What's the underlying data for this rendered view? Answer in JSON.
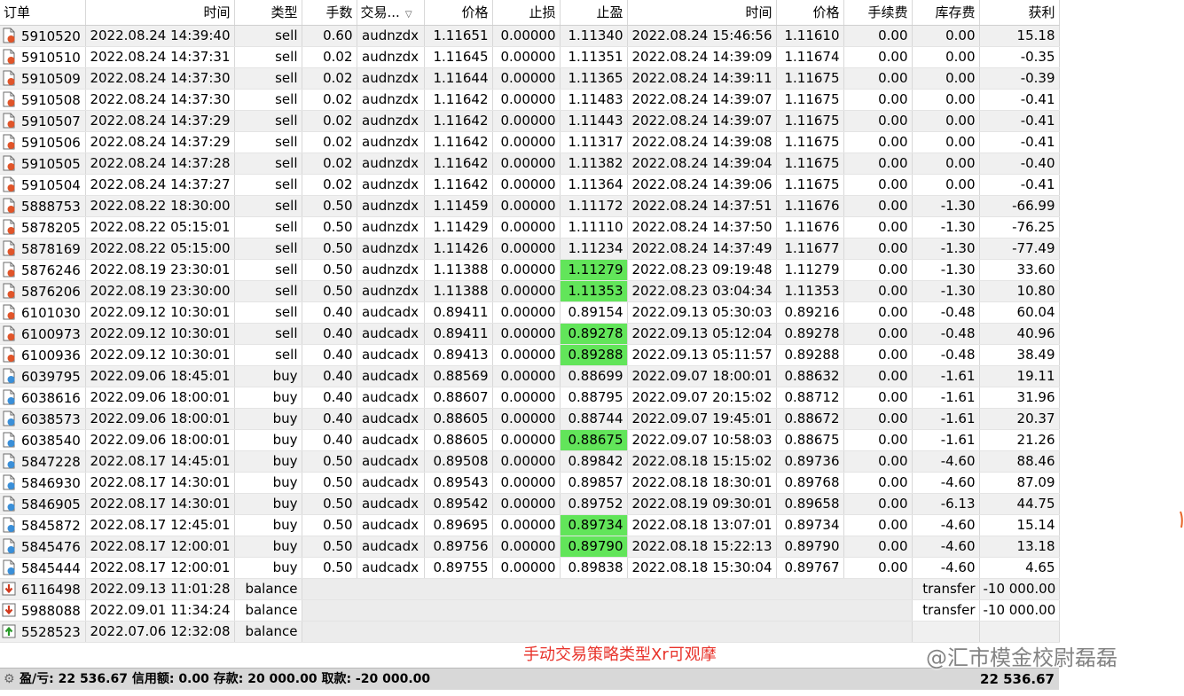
{
  "columns": [
    "订单",
    "时间",
    "类型",
    "手数",
    "交易...",
    "价格",
    "止损",
    "止盈",
    "时间",
    "价格",
    "手续费",
    "库存费",
    "获利"
  ],
  "rows": [
    {
      "order": "5910520",
      "open_time": "2022.08.24 14:39:40",
      "type": "sell",
      "lots": "0.60",
      "symbol": "audnzdx",
      "open_price": "1.11651",
      "sl": "0.00000",
      "tp": "1.11340",
      "tp_hit": false,
      "close_time": "2022.08.24 15:46:56",
      "close_price": "1.11610",
      "commission": "0.00",
      "swap": "0.00",
      "profit": "15.18"
    },
    {
      "order": "5910510",
      "open_time": "2022.08.24 14:37:31",
      "type": "sell",
      "lots": "0.02",
      "symbol": "audnzdx",
      "open_price": "1.11645",
      "sl": "0.00000",
      "tp": "1.11351",
      "tp_hit": false,
      "close_time": "2022.08.24 14:39:09",
      "close_price": "1.11674",
      "commission": "0.00",
      "swap": "0.00",
      "profit": "-0.35"
    },
    {
      "order": "5910509",
      "open_time": "2022.08.24 14:37:30",
      "type": "sell",
      "lots": "0.02",
      "symbol": "audnzdx",
      "open_price": "1.11644",
      "sl": "0.00000",
      "tp": "1.11365",
      "tp_hit": false,
      "close_time": "2022.08.24 14:39:11",
      "close_price": "1.11675",
      "commission": "0.00",
      "swap": "0.00",
      "profit": "-0.39"
    },
    {
      "order": "5910508",
      "open_time": "2022.08.24 14:37:30",
      "type": "sell",
      "lots": "0.02",
      "symbol": "audnzdx",
      "open_price": "1.11642",
      "sl": "0.00000",
      "tp": "1.11483",
      "tp_hit": false,
      "close_time": "2022.08.24 14:39:07",
      "close_price": "1.11675",
      "commission": "0.00",
      "swap": "0.00",
      "profit": "-0.41"
    },
    {
      "order": "5910507",
      "open_time": "2022.08.24 14:37:29",
      "type": "sell",
      "lots": "0.02",
      "symbol": "audnzdx",
      "open_price": "1.11642",
      "sl": "0.00000",
      "tp": "1.11443",
      "tp_hit": false,
      "close_time": "2022.08.24 14:39:07",
      "close_price": "1.11675",
      "commission": "0.00",
      "swap": "0.00",
      "profit": "-0.41"
    },
    {
      "order": "5910506",
      "open_time": "2022.08.24 14:37:29",
      "type": "sell",
      "lots": "0.02",
      "symbol": "audnzdx",
      "open_price": "1.11642",
      "sl": "0.00000",
      "tp": "1.11317",
      "tp_hit": false,
      "close_time": "2022.08.24 14:39:08",
      "close_price": "1.11675",
      "commission": "0.00",
      "swap": "0.00",
      "profit": "-0.41"
    },
    {
      "order": "5910505",
      "open_time": "2022.08.24 14:37:28",
      "type": "sell",
      "lots": "0.02",
      "symbol": "audnzdx",
      "open_price": "1.11642",
      "sl": "0.00000",
      "tp": "1.11382",
      "tp_hit": false,
      "close_time": "2022.08.24 14:39:04",
      "close_price": "1.11675",
      "commission": "0.00",
      "swap": "0.00",
      "profit": "-0.40"
    },
    {
      "order": "5910504",
      "open_time": "2022.08.24 14:37:27",
      "type": "sell",
      "lots": "0.02",
      "symbol": "audnzdx",
      "open_price": "1.11642",
      "sl": "0.00000",
      "tp": "1.11364",
      "tp_hit": false,
      "close_time": "2022.08.24 14:39:06",
      "close_price": "1.11675",
      "commission": "0.00",
      "swap": "0.00",
      "profit": "-0.41"
    },
    {
      "order": "5888753",
      "open_time": "2022.08.22 18:30:00",
      "type": "sell",
      "lots": "0.50",
      "symbol": "audnzdx",
      "open_price": "1.11459",
      "sl": "0.00000",
      "tp": "1.11172",
      "tp_hit": false,
      "close_time": "2022.08.24 14:37:51",
      "close_price": "1.11676",
      "commission": "0.00",
      "swap": "-1.30",
      "profit": "-66.99"
    },
    {
      "order": "5878205",
      "open_time": "2022.08.22 05:15:01",
      "type": "sell",
      "lots": "0.50",
      "symbol": "audnzdx",
      "open_price": "1.11429",
      "sl": "0.00000",
      "tp": "1.11110",
      "tp_hit": false,
      "close_time": "2022.08.24 14:37:50",
      "close_price": "1.11676",
      "commission": "0.00",
      "swap": "-1.30",
      "profit": "-76.25"
    },
    {
      "order": "5878169",
      "open_time": "2022.08.22 05:15:00",
      "type": "sell",
      "lots": "0.50",
      "symbol": "audnzdx",
      "open_price": "1.11426",
      "sl": "0.00000",
      "tp": "1.11234",
      "tp_hit": false,
      "close_time": "2022.08.24 14:37:49",
      "close_price": "1.11677",
      "commission": "0.00",
      "swap": "-1.30",
      "profit": "-77.49"
    },
    {
      "order": "5876246",
      "open_time": "2022.08.19 23:30:01",
      "type": "sell",
      "lots": "0.50",
      "symbol": "audnzdx",
      "open_price": "1.11388",
      "sl": "0.00000",
      "tp": "1.11279",
      "tp_hit": true,
      "close_time": "2022.08.23 09:19:48",
      "close_price": "1.11279",
      "commission": "0.00",
      "swap": "-1.30",
      "profit": "33.60"
    },
    {
      "order": "5876206",
      "open_time": "2022.08.19 23:30:00",
      "type": "sell",
      "lots": "0.50",
      "symbol": "audnzdx",
      "open_price": "1.11388",
      "sl": "0.00000",
      "tp": "1.11353",
      "tp_hit": true,
      "close_time": "2022.08.23 03:04:34",
      "close_price": "1.11353",
      "commission": "0.00",
      "swap": "-1.30",
      "profit": "10.80"
    },
    {
      "order": "6101030",
      "open_time": "2022.09.12 10:30:01",
      "type": "sell",
      "lots": "0.40",
      "symbol": "audcadx",
      "open_price": "0.89411",
      "sl": "0.00000",
      "tp": "0.89154",
      "tp_hit": false,
      "close_time": "2022.09.13 05:30:03",
      "close_price": "0.89216",
      "commission": "0.00",
      "swap": "-0.48",
      "profit": "60.04"
    },
    {
      "order": "6100973",
      "open_time": "2022.09.12 10:30:01",
      "type": "sell",
      "lots": "0.40",
      "symbol": "audcadx",
      "open_price": "0.89411",
      "sl": "0.00000",
      "tp": "0.89278",
      "tp_hit": true,
      "close_time": "2022.09.13 05:12:04",
      "close_price": "0.89278",
      "commission": "0.00",
      "swap": "-0.48",
      "profit": "40.96"
    },
    {
      "order": "6100936",
      "open_time": "2022.09.12 10:30:01",
      "type": "sell",
      "lots": "0.40",
      "symbol": "audcadx",
      "open_price": "0.89413",
      "sl": "0.00000",
      "tp": "0.89288",
      "tp_hit": true,
      "close_time": "2022.09.13 05:11:57",
      "close_price": "0.89288",
      "commission": "0.00",
      "swap": "-0.48",
      "profit": "38.49"
    },
    {
      "order": "6039795",
      "open_time": "2022.09.06 18:45:01",
      "type": "buy",
      "lots": "0.40",
      "symbol": "audcadx",
      "open_price": "0.88569",
      "sl": "0.00000",
      "tp": "0.88699",
      "tp_hit": false,
      "close_time": "2022.09.07 18:00:01",
      "close_price": "0.88632",
      "commission": "0.00",
      "swap": "-1.61",
      "profit": "19.11"
    },
    {
      "order": "6038616",
      "open_time": "2022.09.06 18:00:01",
      "type": "buy",
      "lots": "0.40",
      "symbol": "audcadx",
      "open_price": "0.88607",
      "sl": "0.00000",
      "tp": "0.88795",
      "tp_hit": false,
      "close_time": "2022.09.07 20:15:02",
      "close_price": "0.88712",
      "commission": "0.00",
      "swap": "-1.61",
      "profit": "31.96"
    },
    {
      "order": "6038573",
      "open_time": "2022.09.06 18:00:01",
      "type": "buy",
      "lots": "0.40",
      "symbol": "audcadx",
      "open_price": "0.88605",
      "sl": "0.00000",
      "tp": "0.88744",
      "tp_hit": false,
      "close_time": "2022.09.07 19:45:01",
      "close_price": "0.88672",
      "commission": "0.00",
      "swap": "-1.61",
      "profit": "20.37"
    },
    {
      "order": "6038540",
      "open_time": "2022.09.06 18:00:01",
      "type": "buy",
      "lots": "0.40",
      "symbol": "audcadx",
      "open_price": "0.88605",
      "sl": "0.00000",
      "tp": "0.88675",
      "tp_hit": true,
      "close_time": "2022.09.07 10:58:03",
      "close_price": "0.88675",
      "commission": "0.00",
      "swap": "-1.61",
      "profit": "21.26"
    },
    {
      "order": "5847228",
      "open_time": "2022.08.17 14:45:01",
      "type": "buy",
      "lots": "0.50",
      "symbol": "audcadx",
      "open_price": "0.89508",
      "sl": "0.00000",
      "tp": "0.89842",
      "tp_hit": false,
      "close_time": "2022.08.18 15:15:02",
      "close_price": "0.89736",
      "commission": "0.00",
      "swap": "-4.60",
      "profit": "88.46"
    },
    {
      "order": "5846930",
      "open_time": "2022.08.17 14:30:01",
      "type": "buy",
      "lots": "0.50",
      "symbol": "audcadx",
      "open_price": "0.89543",
      "sl": "0.00000",
      "tp": "0.89857",
      "tp_hit": false,
      "close_time": "2022.08.18 18:30:01",
      "close_price": "0.89768",
      "commission": "0.00",
      "swap": "-4.60",
      "profit": "87.09"
    },
    {
      "order": "5846905",
      "open_time": "2022.08.17 14:30:01",
      "type": "buy",
      "lots": "0.50",
      "symbol": "audcadx",
      "open_price": "0.89542",
      "sl": "0.00000",
      "tp": "0.89752",
      "tp_hit": false,
      "close_time": "2022.08.19 09:30:01",
      "close_price": "0.89658",
      "commission": "0.00",
      "swap": "-6.13",
      "profit": "44.75"
    },
    {
      "order": "5845872",
      "open_time": "2022.08.17 12:45:01",
      "type": "buy",
      "lots": "0.50",
      "symbol": "audcadx",
      "open_price": "0.89695",
      "sl": "0.00000",
      "tp": "0.89734",
      "tp_hit": true,
      "close_time": "2022.08.18 13:07:01",
      "close_price": "0.89734",
      "commission": "0.00",
      "swap": "-4.60",
      "profit": "15.14"
    },
    {
      "order": "5845476",
      "open_time": "2022.08.17 12:00:01",
      "type": "buy",
      "lots": "0.50",
      "symbol": "audcadx",
      "open_price": "0.89756",
      "sl": "0.00000",
      "tp": "0.89790",
      "tp_hit": true,
      "close_time": "2022.08.18 15:22:13",
      "close_price": "0.89790",
      "commission": "0.00",
      "swap": "-4.60",
      "profit": "13.18"
    },
    {
      "order": "5845444",
      "open_time": "2022.08.17 12:00:01",
      "type": "buy",
      "lots": "0.50",
      "symbol": "audcadx",
      "open_price": "0.89755",
      "sl": "0.00000",
      "tp": "0.89838",
      "tp_hit": false,
      "close_time": "2022.08.18 15:30:04",
      "close_price": "0.89767",
      "commission": "0.00",
      "swap": "-4.60",
      "profit": "4.65"
    }
  ],
  "balance_rows": [
    {
      "order": "6116498",
      "time": "2022.09.13 11:01:28",
      "type": "balance",
      "comment": "transfer",
      "amount": "-10 000.00",
      "icon": "withdrawal-arrow-icon"
    },
    {
      "order": "5988088",
      "time": "2022.09.01 11:34:24",
      "type": "balance",
      "comment": "transfer",
      "amount": "-10 000.00",
      "icon": "withdrawal-arrow-icon"
    },
    {
      "order": "5528523",
      "time": "2022.07.06 12:32:08",
      "type": "balance",
      "comment": "",
      "amount": "",
      "icon": "deposit-arrow-icon"
    }
  ],
  "summary": {
    "text": "盈/亏: 22 536.67  信用额: 0.00  存款: 20 000.00  取款: -20 000.00",
    "total": "22 536.67"
  },
  "overlay": {
    "caption": "手动交易策略类型Xr可观摩",
    "watermark": "@汇市模金校尉磊磊"
  },
  "colors": {
    "tp_hit_highlight": "#62e55a",
    "sell_icon": "#e0552a",
    "buy_icon": "#3a8fd8",
    "caption": "#e8322a"
  }
}
